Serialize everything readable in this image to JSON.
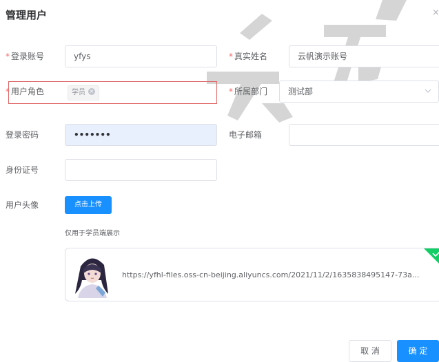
{
  "dialog": {
    "title": "管理用户",
    "close_glyph": "×"
  },
  "form": {
    "required_mark": "*",
    "login_account": {
      "label": "登录账号",
      "value": "yfys"
    },
    "real_name": {
      "label": "真实姓名",
      "value": "云帆演示账号"
    },
    "user_role": {
      "label": "用户角色",
      "tag": "学员",
      "tag_close": "×"
    },
    "department": {
      "label": "所属部门",
      "value": "测试部"
    },
    "password": {
      "label": "登录密码",
      "value": "•••••••"
    },
    "email": {
      "label": "电子邮箱",
      "value": ""
    },
    "id_number": {
      "label": "身份证号",
      "value": ""
    },
    "avatar": {
      "label": "用户头像",
      "upload_button": "点击上传",
      "hint": "仅用于学员端展示",
      "file_url": "https://yfhl-files.oss-cn-beijing.aliyuncs.com/2021/11/2/1635838495147-73a..."
    }
  },
  "footer": {
    "cancel": "取 消",
    "confirm": "确 定"
  },
  "colors": {
    "primary": "#1890ff",
    "required": "#f56c6c",
    "highlight_border": "#e06666",
    "success_corner": "#13ce66",
    "autofill_bg": "#e8f0fe"
  },
  "icons": {
    "close": "close-icon",
    "select_arrow": "chevron-down-icon",
    "upload_success": "check-icon"
  }
}
